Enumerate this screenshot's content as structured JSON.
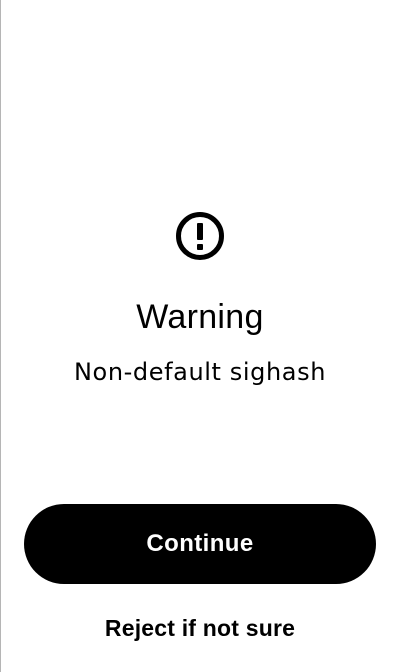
{
  "screen": {
    "icon": "exclamation-circle-icon",
    "title": "Warning",
    "subtitle": "Non-default sighash"
  },
  "actions": {
    "continue_label": "Continue",
    "reject_label": "Reject if not sure"
  },
  "colors": {
    "background": "#ffffff",
    "text": "#000000",
    "primary_button": "#000000",
    "primary_button_text": "#ffffff",
    "left_border": "#b5b5b5"
  }
}
